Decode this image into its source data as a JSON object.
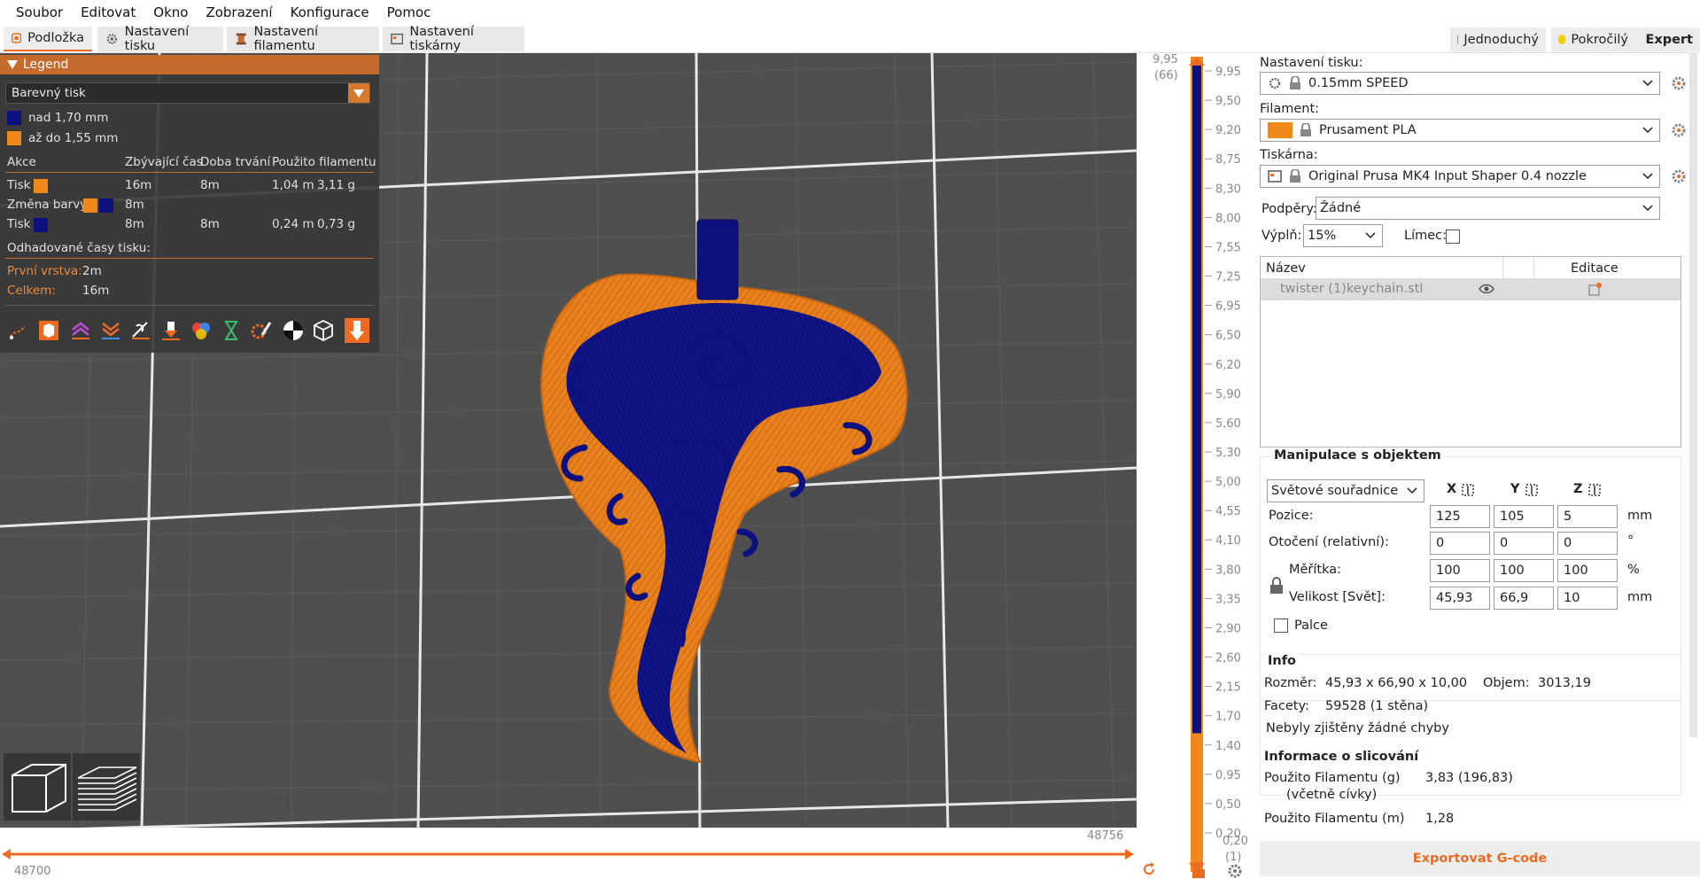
{
  "menu": [
    "Soubor",
    "Editovat",
    "Okno",
    "Zobrazení",
    "Konfigurace",
    "Pomoc"
  ],
  "tabs": {
    "plater": "Podložka",
    "print_settings": "Nastavení tisku",
    "filament_settings": "Nastavení filamentu",
    "printer_settings": "Nastavení tiskárny"
  },
  "modes": {
    "simple": "Jednoduchý",
    "advanced": "Pokročilý",
    "expert": "Expert",
    "colors": {
      "simple": "#00b000",
      "advanced": "#ffd700",
      "expert": "#e00000"
    }
  },
  "legend": {
    "title": "Legend",
    "view_type": "Barevný tisk",
    "items": [
      {
        "label": "nad 1,70 mm",
        "color": "#0d117d"
      },
      {
        "label": "až do 1,55 mm",
        "color": "#f0891c"
      }
    ],
    "headers": {
      "action": "Akce",
      "remaining": "Zbývající čas",
      "duration": "Doba trvání",
      "used": "Použito filamentu"
    },
    "rows": [
      {
        "action": "Tisk",
        "remaining": "16m",
        "duration": "8m",
        "length": "1,04 m",
        "weight": "3,11 g"
      },
      {
        "action": "Změna barvy",
        "remaining": "8m",
        "duration": "",
        "length": "",
        "weight": ""
      },
      {
        "action": "Tisk",
        "remaining": "8m",
        "duration": "8m",
        "length": "0,24 m",
        "weight": "0,73 g"
      }
    ],
    "estimated_title": "Odhadované časy tisku:",
    "first_layer_label": "První vrstva:",
    "first_layer_value": "2m",
    "total_label": "Celkem:",
    "total_value": "16m"
  },
  "vslider": {
    "top_value": "9,95",
    "top_layer": "(66)",
    "bottom_value": "0,20",
    "bottom_layer": "(1)",
    "ticks": [
      "9,95",
      "9,50",
      "9,20",
      "8,75",
      "8,30",
      "8,00",
      "7,55",
      "7,25",
      "6,95",
      "6,50",
      "6,20",
      "5,90",
      "5,60",
      "5,30",
      "5,00",
      "4,55",
      "4,10",
      "3,80",
      "3,35",
      "2,90",
      "2,60",
      "2,15",
      "1,70",
      "1,40",
      "0,95",
      "0,50",
      "0,20"
    ],
    "change_fraction": 0.17
  },
  "hslider": {
    "left_value": "48700",
    "right_value": "48756"
  },
  "panel": {
    "print_settings_label": "Nastavení tisku:",
    "print_profile": "0.15mm SPEED",
    "filament_label": "Filament:",
    "filament_profile": "Prusament PLA",
    "filament_color": "#f0891c",
    "printer_label": "Tiskárna:",
    "printer_profile": "Original Prusa MK4 Input Shaper 0.4 nozzle",
    "supports_label": "Podpěry:",
    "supports_value": "Žádné",
    "infill_label": "Výplň:",
    "infill_value": "15%",
    "brim_label": "Límec:",
    "objects": {
      "col_name": "Název",
      "col_edit": "Editace",
      "items": [
        "twister (1)keychain.stl"
      ]
    },
    "manip": {
      "title": "Manipulace s objektem",
      "coord_system": "Světové souřadnice",
      "x": "X",
      "y": "Y",
      "z": "Z",
      "position_label": "Pozice:",
      "position": [
        "125",
        "105",
        "5"
      ],
      "position_unit": "mm",
      "rotation_label": "Otočení (relativní):",
      "rotation": [
        "0",
        "0",
        "0"
      ],
      "rotation_unit": "°",
      "scale_label": "Měřítka:",
      "scale": [
        "100",
        "100",
        "100"
      ],
      "scale_unit": "%",
      "size_label": "Velikost [Svět]:",
      "size": [
        "45,93",
        "66,9",
        "10"
      ],
      "size_unit": "mm",
      "inches_label": "Palce"
    },
    "info": {
      "title": "Info",
      "size_label": "Rozměr:",
      "size_value": "45,93 x 66,90 x 10,00",
      "volume_label": "Objem:",
      "volume_value": "3013,19",
      "facets_label": "Facety:",
      "facets_value": "59528 (1 stěna)",
      "errors": "Nebyly zjištěny žádné chyby"
    },
    "slice": {
      "title": "Informace o slicování",
      "grams_label": "Použito Filamentu (g)",
      "grams_sub": "(včetně cívky)",
      "grams_value": "3,83 (196,83)",
      "meters_label": "Použito Filamentu (m)",
      "meters_value": "1,28"
    },
    "export": "Exportovat G-code"
  },
  "colors": {
    "accent": "#ed6b21",
    "navy": "#0d117d",
    "orange": "#f0891c",
    "bed": "#4f4f4f"
  }
}
